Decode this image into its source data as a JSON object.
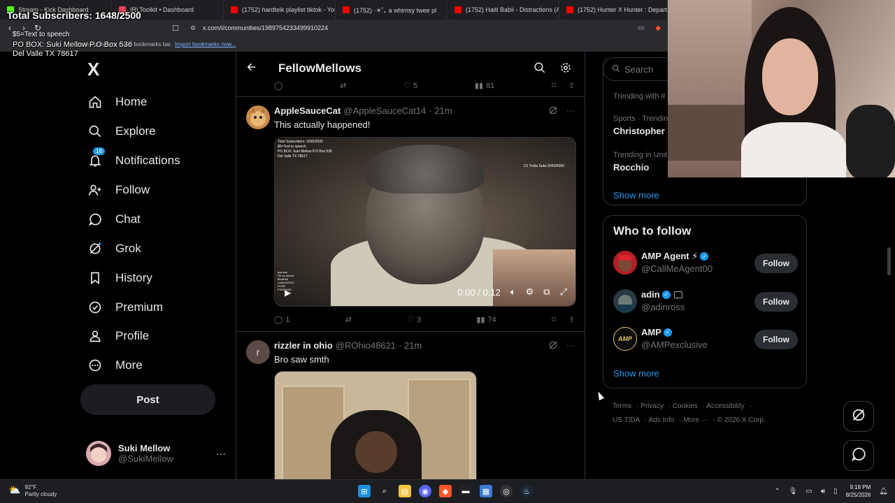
{
  "overlay": {
    "subs": "Total Subscribers: 1648/2500",
    "tts": "$5=Text to speech",
    "po_line1": "PO BOX: Suki Mellow P.O Box 536",
    "po_line2": "Del Valle TX 78617"
  },
  "browser": {
    "tabs": [
      {
        "label": "Stream - Kick Dashboard",
        "color": "#53fc18"
      },
      {
        "label": "IRLToolkit • Dashboard",
        "color": "#e8445a"
      },
      {
        "label": "(1752) hardteik playlist tiktok - You",
        "color": "#ff0000"
      },
      {
        "label": "(1752) ·☀︎˚｡ a whimsy twee pl",
        "color": "#ff0000"
      },
      {
        "label": "(1752) Haiti Babii - Distractions (Au",
        "color": "#ff0000"
      },
      {
        "label": "(1752) Hunter X Hunter : Departure",
        "color": "#ff0000"
      }
    ],
    "url": "x.com/i/communities/1989754233499910224",
    "bookmarks_text": "bookmarks here in the bookmarks bar.",
    "bookmarks_link": "Import bookmarks now..."
  },
  "sidebar": {
    "logo": "X",
    "items": [
      {
        "label": "Home",
        "icon": "home-icon"
      },
      {
        "label": "Explore",
        "icon": "search-icon"
      },
      {
        "label": "Notifications",
        "icon": "bell-icon",
        "badge": "18"
      },
      {
        "label": "Follow",
        "icon": "add-person-icon"
      },
      {
        "label": "Chat",
        "icon": "chat-bubble-icon"
      },
      {
        "label": "Grok",
        "icon": "grok-icon"
      },
      {
        "label": "History",
        "icon": "bookmark-icon"
      },
      {
        "label": "Premium",
        "icon": "verified-badge-icon"
      },
      {
        "label": "Profile",
        "icon": "person-icon"
      },
      {
        "label": "More",
        "icon": "more-circle-icon"
      }
    ],
    "post_label": "Post",
    "account": {
      "name": "Suki Mellow",
      "handle": "@SukiMellow",
      "more": "···"
    }
  },
  "main": {
    "title": "FellowMellows",
    "prev_actions": {
      "replies": "",
      "retweets": "",
      "likes": "5",
      "views": "81"
    },
    "tweets": [
      {
        "display_name": "AppleSauceCat",
        "handle": "@AppleSauceCat14",
        "time": "· 21m",
        "text": "This actually happened!",
        "video": {
          "time": "0:00 / 0:12",
          "top_left": [
            "Total Subscribers: 1660/2500",
            "$5=Text to speech",
            "PO BOX: Suki Mellow P.O Box 536",
            "Del Valle TX 78617"
          ],
          "top_right": "D1 Trolla Subs 5040/5050",
          "chat": [
            "gay ass",
            "I'm so turned",
            "BlueRoll",
            "LMAOOOOO",
            "POSE",
            "PISSSSSS"
          ]
        },
        "actions": {
          "replies": "1",
          "retweets": "",
          "likes": "3",
          "views": "74"
        }
      },
      {
        "display_name": "rizzler in ohio",
        "handle": "@ROhio48621",
        "time": "· 21m",
        "avatar_letter": "r",
        "text": "Bro saw smth"
      }
    ]
  },
  "right": {
    "search_placeholder": "Search",
    "trends": [
      {
        "meta": "Trending with #",
        "name": ""
      },
      {
        "meta": "Sports · Trendin",
        "name": "Christopher M"
      },
      {
        "meta": "Trending in Unit",
        "name": "Rocchio"
      }
    ],
    "show_more": "Show more",
    "who_to_follow": {
      "title": "Who to follow",
      "items": [
        {
          "name": "AMP Agent ⚡",
          "handle": "@CallMeAgent00",
          "button": "Follow"
        },
        {
          "name": "adin",
          "handle": "@adinross",
          "button": "Follow"
        },
        {
          "name": "AMP",
          "handle": "@AMPexclusive",
          "button": "Follow"
        }
      ],
      "show_more": "Show more"
    },
    "footer": [
      "Terms",
      "Privacy",
      "Cookies",
      "Accessibility",
      "US TIDA",
      "Ads Info",
      "More ···",
      "© 2026 X Corp."
    ]
  },
  "taskbar": {
    "temp": "92°F",
    "weather": "Partly cloudy",
    "time": "9:18 PM",
    "date": "8/25/2026"
  }
}
